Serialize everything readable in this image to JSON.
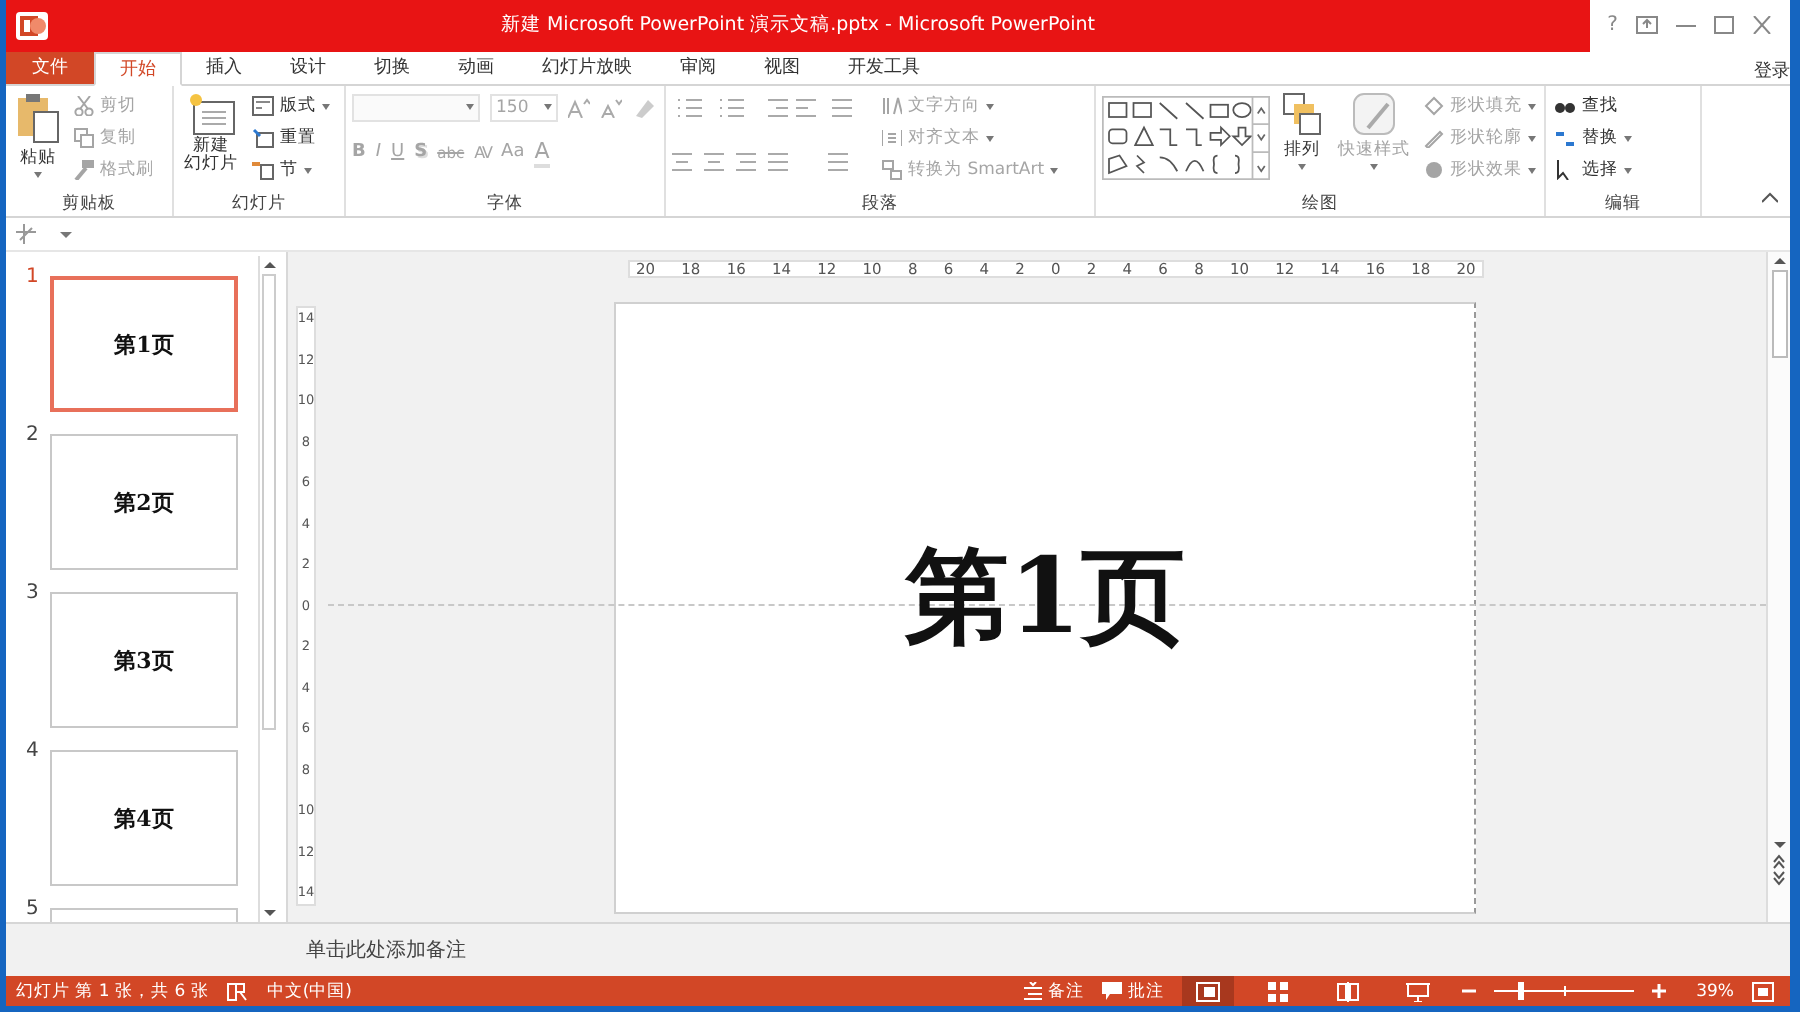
{
  "window": {
    "title": "新建 Microsoft PowerPoint 演示文稿.pptx -  Microsoft PowerPoint",
    "help": "?",
    "account": "登录"
  },
  "tabs": [
    {
      "label": "文件",
      "kind": "file",
      "selected": false
    },
    {
      "label": "开始",
      "kind": "tab",
      "selected": true
    },
    {
      "label": "插入",
      "kind": "tab",
      "selected": false
    },
    {
      "label": "设计",
      "kind": "tab",
      "selected": false
    },
    {
      "label": "切换",
      "kind": "tab",
      "selected": false
    },
    {
      "label": "动画",
      "kind": "tab",
      "selected": false
    },
    {
      "label": "幻灯片放映",
      "kind": "tab",
      "selected": false
    },
    {
      "label": "审阅",
      "kind": "tab",
      "selected": false
    },
    {
      "label": "视图",
      "kind": "tab",
      "selected": false
    },
    {
      "label": "开发工具",
      "kind": "tab",
      "selected": false
    }
  ],
  "ribbon": {
    "clipboard": {
      "title": "剪贴板",
      "paste": "粘贴",
      "items": [
        {
          "kind": "cut",
          "label": "剪切",
          "disabled": true
        },
        {
          "kind": "copy",
          "label": "复制",
          "disabled": true
        },
        {
          "kind": "painter",
          "label": "格式刷",
          "disabled": true
        }
      ]
    },
    "slides": {
      "title": "幻灯片",
      "new_slide": [
        "新建",
        "幻灯片"
      ],
      "items": [
        {
          "kind": "layout",
          "label": "版式"
        },
        {
          "kind": "reset",
          "label": "重置"
        },
        {
          "kind": "section",
          "label": "节"
        }
      ]
    },
    "font": {
      "title": "字体",
      "font_size": "150",
      "disabled": true,
      "format_buttons": [
        {
          "kind": "bold",
          "label": "B"
        },
        {
          "kind": "italic",
          "label": "I"
        },
        {
          "kind": "underline",
          "label": "U"
        },
        {
          "kind": "shadow",
          "label": "S"
        },
        {
          "kind": "strike",
          "label": "abc"
        },
        {
          "kind": "spacing",
          "label": "AV"
        },
        {
          "kind": "case",
          "label": "Aa"
        },
        {
          "kind": "color",
          "label": "A"
        }
      ]
    },
    "paragraph": {
      "title": "段落",
      "items": [
        {
          "kind": "text-direction",
          "label": "文字方向",
          "disabled": true
        },
        {
          "kind": "align-text",
          "label": "对齐文本",
          "disabled": true
        },
        {
          "kind": "smartart",
          "label": "转换为 SmartArt",
          "disabled": true
        }
      ]
    },
    "drawing": {
      "title": "绘图",
      "arrange": "排列",
      "quick_styles": {
        "label": "快速样式",
        "disabled": true
      },
      "items": [
        {
          "kind": "fill",
          "label": "形状填充",
          "disabled": true
        },
        {
          "kind": "outline",
          "label": "形状轮廓",
          "disabled": true
        },
        {
          "kind": "effects",
          "label": "形状效果",
          "disabled": true
        }
      ]
    },
    "editing": {
      "title": "编辑",
      "items": [
        {
          "kind": "find",
          "label": "查找",
          "disabled": false
        },
        {
          "kind": "replace",
          "label": "替换",
          "disabled": false
        },
        {
          "kind": "select",
          "label": "选择",
          "disabled": false
        }
      ]
    }
  },
  "rulers": {
    "horizontal": [
      "20",
      "18",
      "16",
      "14",
      "12",
      "10",
      "8",
      "6",
      "4",
      "2",
      "0",
      "2",
      "4",
      "6",
      "8",
      "10",
      "12",
      "14",
      "16",
      "18",
      "20"
    ],
    "vertical": [
      "14",
      "12",
      "10",
      "8",
      "6",
      "4",
      "2",
      "0",
      "2",
      "4",
      "6",
      "8",
      "10",
      "12",
      "14"
    ]
  },
  "thumbnails": [
    {
      "number": "1",
      "title": "第1页",
      "selected": true
    },
    {
      "number": "2",
      "title": "第2页",
      "selected": false
    },
    {
      "number": "3",
      "title": "第3页",
      "selected": false
    },
    {
      "number": "4",
      "title": "第4页",
      "selected": false
    },
    {
      "number": "5",
      "selected": false
    }
  ],
  "slide": {
    "title": "第1页"
  },
  "notes": {
    "placeholder": "单击此处添加备注"
  },
  "status_bar": {
    "slide_info": "幻灯片 第 1 张，共 6 张",
    "language": "中文(中国)",
    "notes": "备注",
    "comments": "批注",
    "views": [
      {
        "kind": "normal",
        "selected": true
      },
      {
        "kind": "sorter",
        "selected": false
      },
      {
        "kind": "reading",
        "selected": false
      },
      {
        "kind": "slideshow",
        "selected": false
      }
    ],
    "zoom": {
      "level": 0.18
    },
    "zoom_percent": "39%"
  }
}
